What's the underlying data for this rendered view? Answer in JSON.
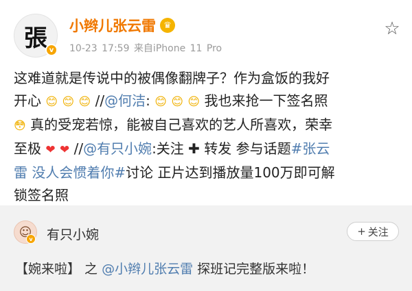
{
  "post": {
    "avatar_char": "張",
    "username": "小辫儿张云雷",
    "timestamp": "10-23 17:59",
    "source": "来自iPhone 11 Pro",
    "icons": {
      "star": "star-icon",
      "crown": "crown-icon",
      "verified": "verified-icon"
    },
    "content": {
      "line1": "这难道就是传说中的被偶像翻牌子？作为盒饭的我好",
      "line2_a": "开心",
      "slashes_1": "//",
      "mention_1": "@何洁",
      "colon_1": ":",
      "line2_b": "我也来抢一下签名照",
      "line3": "真的受宠若惊，能被自己喜欢的艺人所喜欢，荣幸",
      "line4_a": "至极",
      "slashes_2": "//",
      "mention_2": "@有只小婉",
      "line4_b": ":关注",
      "line4_c": "转发 参与话题",
      "hashtag_1": "#张云",
      "hashtag_2": "雷 没人会惯着你#",
      "line5_b": "讨论 正片达到播放量100万即可解",
      "line6": "锁签名照"
    }
  },
  "repost": {
    "username": "有只小婉",
    "follow_label": "关注",
    "text_prefix": "【婉来啦】 之 ",
    "mention": "@小辫儿张云雷",
    "text_suffix": " 探班记完整版来啦！"
  }
}
